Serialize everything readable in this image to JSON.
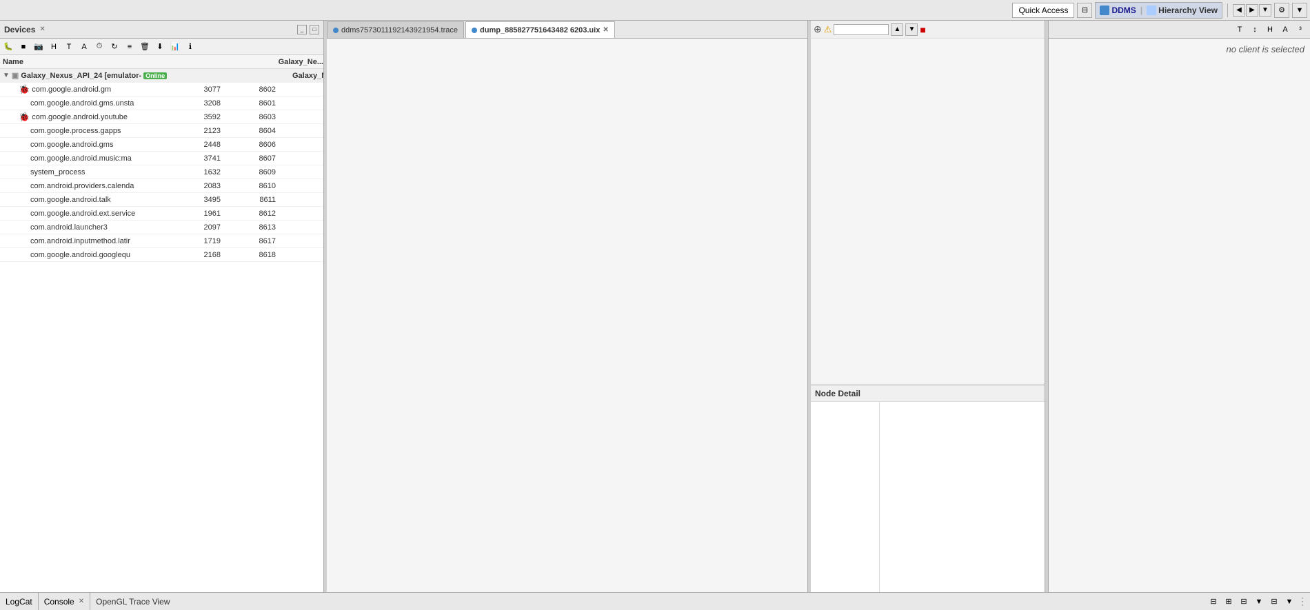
{
  "topbar": {
    "quick_access_label": "Quick Access",
    "ddms_label": "DDMS",
    "hierarchy_view_label": "Hierarchy View"
  },
  "devices_panel": {
    "title": "Devices",
    "columns": {
      "name": "Name",
      "pid": "",
      "port": "",
      "galaxy": "Galaxy_Ne..."
    },
    "device": {
      "name": "Galaxy_Nexus_API_24 [emulator-",
      "status": "Online"
    },
    "processes": [
      {
        "name": "com.google.android.gm",
        "pid": "3077",
        "port": "8602",
        "hasIcon": true
      },
      {
        "name": "com.google.android.gms.unsta",
        "pid": "3208",
        "port": "8601",
        "hasIcon": false
      },
      {
        "name": "com.google.android.youtube",
        "pid": "3592",
        "port": "8603",
        "hasIcon": true
      },
      {
        "name": "com.google.process.gapps",
        "pid": "2123",
        "port": "8604",
        "hasIcon": false
      },
      {
        "name": "com.google.android.gms",
        "pid": "2448",
        "port": "8606",
        "hasIcon": false
      },
      {
        "name": "com.google.android.music:ma",
        "pid": "3741",
        "port": "8607",
        "hasIcon": false
      },
      {
        "name": "system_process",
        "pid": "1632",
        "port": "8609",
        "hasIcon": false
      },
      {
        "name": "com.android.providers.calenda",
        "pid": "2083",
        "port": "8610",
        "hasIcon": false
      },
      {
        "name": "com.google.android.talk",
        "pid": "3495",
        "port": "8611",
        "hasIcon": false
      },
      {
        "name": "com.google.android.ext.service",
        "pid": "1961",
        "port": "8612",
        "hasIcon": false
      },
      {
        "name": "com.android.launcher3",
        "pid": "2097",
        "port": "8613",
        "hasIcon": false
      },
      {
        "name": "com.android.inputmethod.latin",
        "pid": "1719",
        "port": "8617",
        "hasIcon": false
      },
      {
        "name": "com.google.android.googlequ",
        "pid": "2168",
        "port": "8618",
        "hasIcon": false
      }
    ]
  },
  "tabs": {
    "trace_tab": "ddms7573011192143921954.trace",
    "dump_tab": "dump_885827751643482 6203.uix"
  },
  "hierarchy_panel": {
    "node_detail_label": "Node Detail"
  },
  "far_right": {
    "no_client_text": "no client is selected"
  },
  "bottom": {
    "logcat_label": "LogCat",
    "console_label": "Console",
    "opengl_trace_label": "OpenGL Trace View"
  }
}
